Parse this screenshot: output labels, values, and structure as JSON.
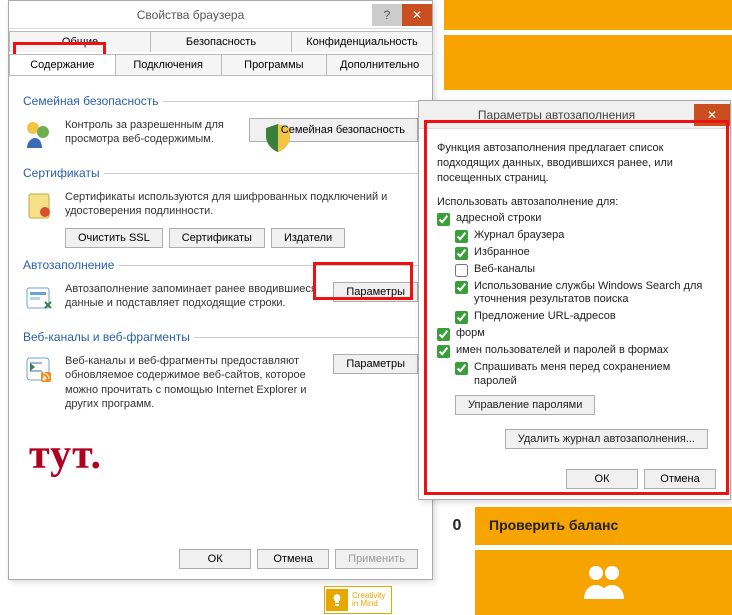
{
  "bg": {
    "balance_label": "Проверить баланс",
    "balance_num": "0"
  },
  "dlg": {
    "title": "Свойства браузера",
    "tabs_row1": [
      "Общие",
      "Безопасность",
      "Конфиденциальность"
    ],
    "tabs_row2": [
      "Содержание",
      "Подключения",
      "Программы",
      "Дополнительно"
    ],
    "active_tab": "Содержание",
    "family": {
      "legend": "Семейная безопасность",
      "text": "Контроль за разрешенным для просмотра веб-содержимым.",
      "btn": "Семейная безопасность"
    },
    "cert": {
      "legend": "Сертификаты",
      "text": "Сертификаты используются для шифрованных подключений и удостоверения подлинности.",
      "btns": [
        "Очистить SSL",
        "Сертификаты",
        "Издатели"
      ]
    },
    "auto": {
      "legend": "Автозаполнение",
      "text": "Автозаполнение запоминает ранее вводившиеся данные и подставляет подходящие строки.",
      "btn": "Параметры"
    },
    "feed": {
      "legend": "Веб-каналы и веб-фрагменты",
      "text": "Веб-каналы и веб-фрагменты предоставляют обновляемое содержимое веб-сайтов, которое можно прочитать с помощью Internet Explorer и других программ.",
      "btn": "Параметры"
    },
    "footer": {
      "ok": "ОК",
      "cancel": "Отмена",
      "apply": "Применить"
    },
    "watermark": "тут."
  },
  "sec": {
    "title": "Параметры автозаполнения",
    "intro": "Функция автозаполнения предлагает список подходящих данных, вводившихся ранее, или посещенных страниц.",
    "use_for": "Использовать автозаполнение для:",
    "checks": {
      "address": {
        "label": "адресной строки",
        "checked": true
      },
      "history": {
        "label": "Журнал браузера",
        "checked": true
      },
      "fav": {
        "label": "Избранное",
        "checked": true
      },
      "feeds": {
        "label": "Веб-каналы",
        "checked": false
      },
      "winsearch": {
        "label": "Использование службы Windows Search для уточнения результатов поиска",
        "checked": true
      },
      "url": {
        "label": "Предложение URL-адресов",
        "checked": true
      },
      "form": {
        "label": "форм",
        "checked": true
      },
      "userpass": {
        "label": "имен пользователей и паролей в формах",
        "checked": true
      },
      "asksave": {
        "label": "Спрашивать меня перед сохранением паролей",
        "checked": true
      }
    },
    "manage_pw": "Управление паролями",
    "delete_hist": "Удалить журнал автозаполнения...",
    "ok": "ОК",
    "cancel": "Отмена"
  },
  "logo": {
    "line1": "Creativity",
    "line2": "in Mind"
  }
}
